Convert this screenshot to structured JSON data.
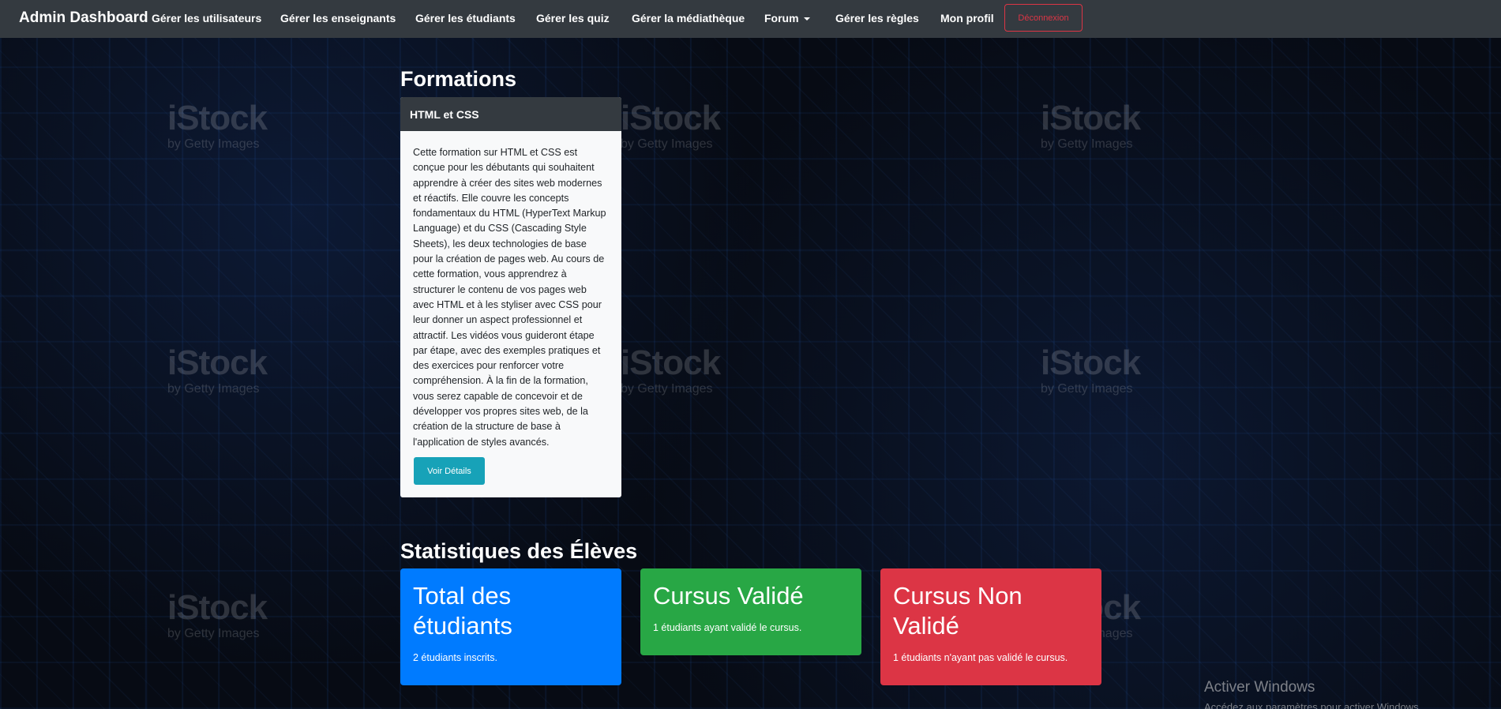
{
  "watermark": {
    "brand": "iStock",
    "sub": "by Getty Images"
  },
  "navbar": {
    "brand": "Admin Dashboard",
    "items": [
      {
        "label": "Gérer les utilisateurs"
      },
      {
        "label": "Gérer les enseignants"
      },
      {
        "label": "Gérer les étudiants"
      },
      {
        "label": "Gérer les quiz"
      },
      {
        "label": "Gérer la médiathèque"
      },
      {
        "label": "Forum"
      },
      {
        "label": "Gérer les règles"
      },
      {
        "label": "Mon profil"
      }
    ],
    "logout": "Déconnexion"
  },
  "formations": {
    "title": "Formations",
    "course": {
      "name": "HTML et CSS",
      "description": "Cette formation sur HTML et CSS est conçue pour les débutants qui souhaitent apprendre à créer des sites web modernes et réactifs. Elle couvre les concepts fondamentaux du HTML (HyperText Markup Language) et du CSS (Cascading Style Sheets), les deux technologies de base pour la création de pages web. Au cours de cette formation, vous apprendrez à structurer le contenu de vos pages web avec HTML et à les styliser avec CSS pour leur donner un aspect professionnel et attractif. Les vidéos vous guideront étape par étape, avec des exemples pratiques et des exercices pour renforcer votre compréhension. À la fin de la formation, vous serez capable de concevoir et de développer vos propres sites web, de la création de la structure de base à l'application de styles avancés.",
      "button": "Voir Détails"
    }
  },
  "stats": {
    "title": "Statistiques des Élèves",
    "cards": [
      {
        "title": "Total des étudiants",
        "text": "2 étudiants inscrits.",
        "color": "#007bff"
      },
      {
        "title": "Cursus Validé",
        "text": "1 étudiants ayant validé le cursus.",
        "color": "#28a745"
      },
      {
        "title": "Cursus Non Validé",
        "text": "1 étudiants n'ayant pas validé le cursus.",
        "color": "#dc3545"
      }
    ]
  },
  "windows": {
    "activate_title": "Activer Windows",
    "activate_sub": "Accédez aux paramètres pour activer Windows."
  }
}
